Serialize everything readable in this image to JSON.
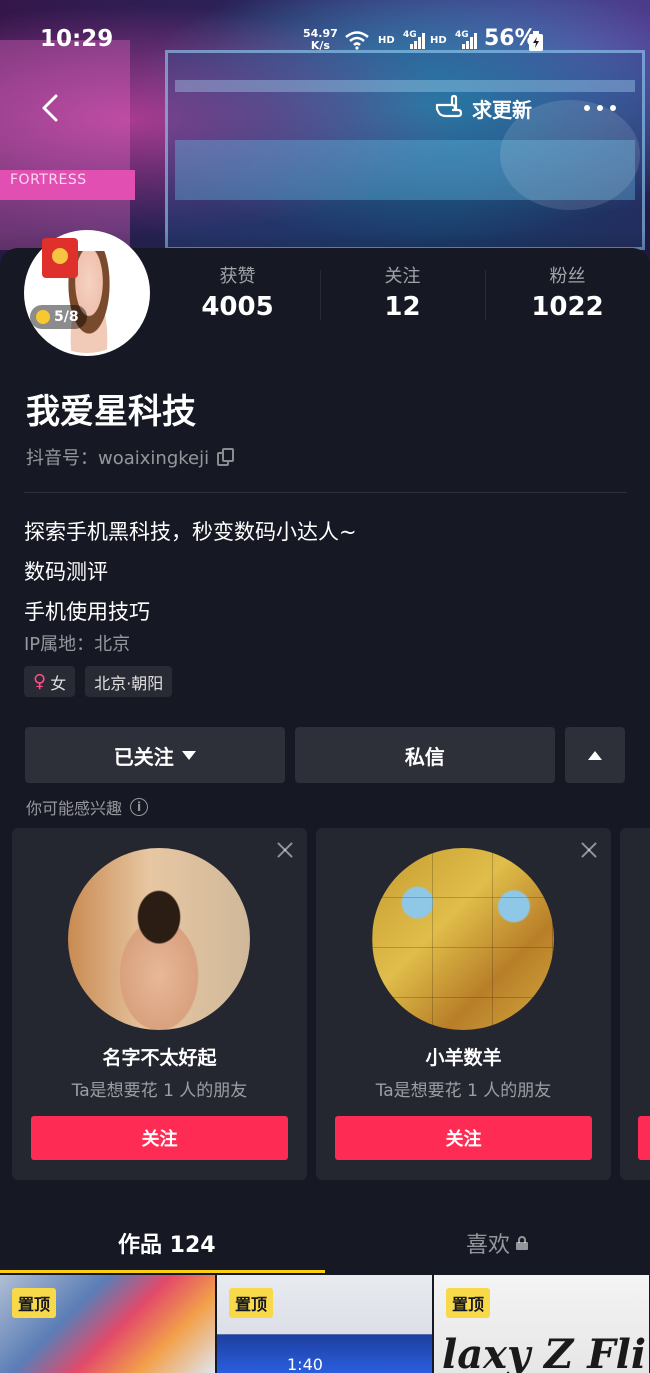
{
  "status_bar": {
    "time": "10:29",
    "net_speed_value": "54.97",
    "net_speed_unit": "K/s",
    "hd1": "HD",
    "hd2": "HD",
    "net_type1": "4G",
    "net_type2": "4G",
    "battery": "56%"
  },
  "banner": {
    "sign_text": "FORTRESS"
  },
  "nav": {
    "refresh_label": "求更新"
  },
  "profile": {
    "coin_progress": "5/8",
    "stats": [
      {
        "label": "获赞",
        "value": "4005"
      },
      {
        "label": "关注",
        "value": "12"
      },
      {
        "label": "粉丝",
        "value": "1022"
      }
    ],
    "nickname": "我爱星科技",
    "douyin_id": "抖音号：woaixingkeji",
    "bio_lines": [
      "探索手机黑科技，秒变数码小达人~",
      "数码测评",
      "手机使用技巧"
    ],
    "ip_location": "IP属地：北京",
    "tags": {
      "gender": "女",
      "location": "北京·朝阳"
    }
  },
  "actions": {
    "followed_label": "已关注",
    "message_label": "私信"
  },
  "suggestions": {
    "title": "你可能感兴趣",
    "cards": [
      {
        "name": "名字不太好起",
        "subtitle": "Ta是想要花 1 人的朋友",
        "button": "关注"
      },
      {
        "name": "小羊数羊",
        "subtitle": "Ta是想要花 1 人的朋友",
        "button": "关注"
      }
    ]
  },
  "tabs": {
    "works_label": "作品 124",
    "likes_label": "喜欢"
  },
  "grid": {
    "pin_label": "置顶",
    "thumb2_clock": "1:40",
    "thumb3_brand": "laxy Z Fli"
  },
  "colors": {
    "accent_red": "#fe2c55",
    "tab_underline": "#face15",
    "background": "#161823"
  }
}
